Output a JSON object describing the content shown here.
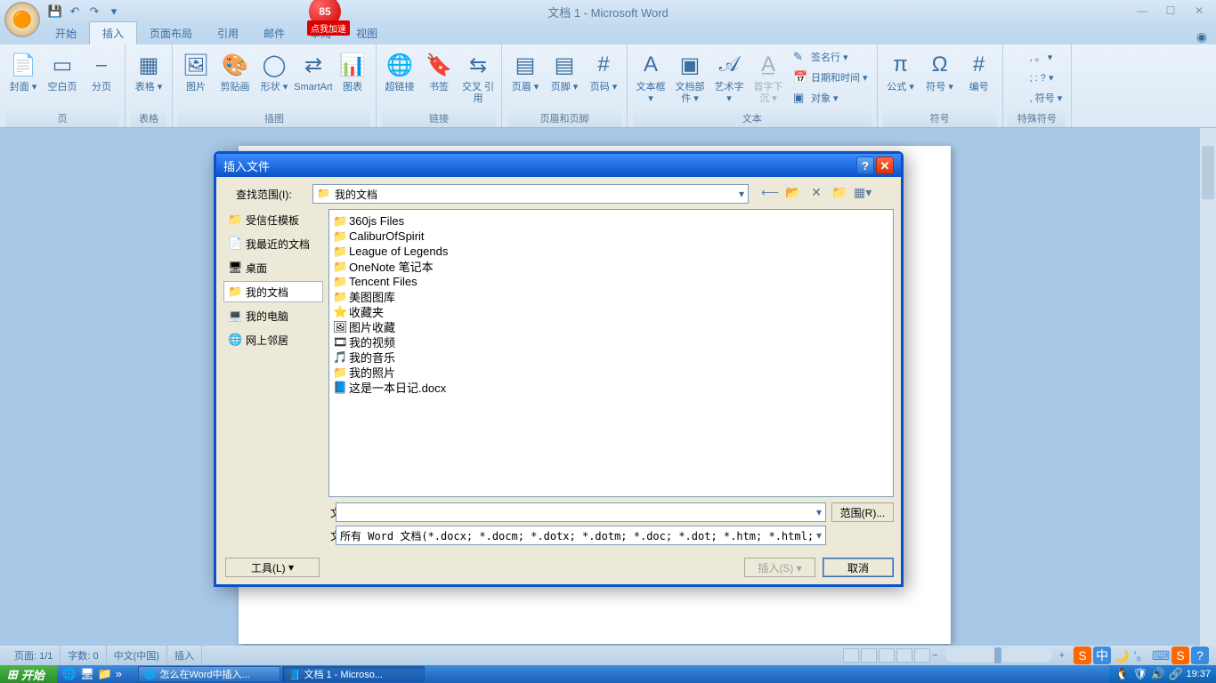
{
  "titlebar": {
    "title": "文档 1 - Microsoft Word",
    "badge_num": "85",
    "badge_text": "点我加速"
  },
  "tabs": {
    "items": [
      "开始",
      "插入",
      "页面布局",
      "引用",
      "邮件",
      "审阅",
      "视图"
    ],
    "active_index": 1
  },
  "ribbon": {
    "groups": [
      {
        "label": "页",
        "items": [
          {
            "label": "封面",
            "icon": "📄",
            "dd": true
          },
          {
            "label": "空白页",
            "icon": "▭"
          },
          {
            "label": "分页",
            "icon": "⎯"
          }
        ]
      },
      {
        "label": "表格",
        "items": [
          {
            "label": "表格",
            "icon": "▦",
            "dd": true
          }
        ]
      },
      {
        "label": "插图",
        "items": [
          {
            "label": "图片",
            "icon": "🖼"
          },
          {
            "label": "剪贴画",
            "icon": "🎨"
          },
          {
            "label": "形状",
            "icon": "◯",
            "dd": true
          },
          {
            "label": "SmartArt",
            "icon": "⇄"
          },
          {
            "label": "图表",
            "icon": "📊"
          }
        ]
      },
      {
        "label": "链接",
        "items": [
          {
            "label": "超链接",
            "icon": "🌐"
          },
          {
            "label": "书签",
            "icon": "🔖"
          },
          {
            "label": "交叉\n引用",
            "icon": "⇆"
          }
        ]
      },
      {
        "label": "页眉和页脚",
        "items": [
          {
            "label": "页眉",
            "icon": "▤",
            "dd": true
          },
          {
            "label": "页脚",
            "icon": "▤",
            "dd": true
          },
          {
            "label": "页码",
            "icon": "#",
            "dd": true
          }
        ]
      },
      {
        "label": "文本",
        "items": [
          {
            "label": "文本框",
            "icon": "A",
            "dd": true
          },
          {
            "label": "文档部件",
            "icon": "▣",
            "dd": true
          },
          {
            "label": "艺术字",
            "icon": "𝒜",
            "dd": true
          },
          {
            "label": "首字下沉",
            "icon": "A̲",
            "dd": true,
            "disabled": true
          }
        ],
        "small": [
          {
            "label": "签名行",
            "icon": "✎"
          },
          {
            "label": "日期和时间",
            "icon": "📅"
          },
          {
            "label": "对象",
            "icon": "▣"
          }
        ]
      },
      {
        "label": "符号",
        "items": [
          {
            "label": "公式",
            "icon": "π",
            "dd": true
          },
          {
            "label": "符号",
            "icon": "Ω",
            "dd": true
          },
          {
            "label": "编号",
            "icon": "#"
          }
        ]
      },
      {
        "label": "特殊符号",
        "items": [],
        "small": [
          {
            "label": ", 。",
            "icon": ""
          },
          {
            "label": "; : ?",
            "icon": ""
          },
          {
            "label": ", 符号",
            "icon": ""
          }
        ]
      }
    ]
  },
  "dialog": {
    "title": "插入文件",
    "lookin_label": "查找范围(I):",
    "lookin_value": "我的文档",
    "sidebar": [
      {
        "label": "受信任模板",
        "icon": "📁"
      },
      {
        "label": "我最近的文档",
        "icon": "📄"
      },
      {
        "label": "桌面",
        "icon": "🖥"
      },
      {
        "label": "我的文档",
        "icon": "📁",
        "selected": true
      },
      {
        "label": "我的电脑",
        "icon": "💻"
      },
      {
        "label": "网上邻居",
        "icon": "🌐"
      }
    ],
    "files": [
      {
        "name": "360js Files",
        "icon": "📁"
      },
      {
        "name": "CaliburOfSpirit",
        "icon": "📁"
      },
      {
        "name": "League of Legends",
        "icon": "📁"
      },
      {
        "name": "OneNote 笔记本",
        "icon": "📁"
      },
      {
        "name": "Tencent Files",
        "icon": "📁"
      },
      {
        "name": "美图图库",
        "icon": "📁"
      },
      {
        "name": "收藏夹",
        "icon": "⭐"
      },
      {
        "name": "图片收藏",
        "icon": "🖼"
      },
      {
        "name": "我的视频",
        "icon": "🎞"
      },
      {
        "name": "我的音乐",
        "icon": "🎵"
      },
      {
        "name": "我的照片",
        "icon": "📁"
      },
      {
        "name": "这是一本日记.docx",
        "icon": "📘"
      }
    ],
    "filename_label": "文件名(N):",
    "filename_value": "",
    "filetype_label": "文件类型(T):",
    "filetype_value": "所有 Word 文档(*.docx; *.docm; *.dotx; *.dotm; *.doc; *.dot; *.htm; *.html;",
    "range_btn": "范围(R)...",
    "tools_btn": "工具(L)",
    "insert_btn": "插入(S)",
    "cancel_btn": "取消"
  },
  "statusbar": {
    "page": "页面: 1/1",
    "words": "字数: 0",
    "lang": "中文(中国)",
    "mode": "插入"
  },
  "taskbar": {
    "start": "开始",
    "tasks": [
      {
        "label": "怎么在Word中插入...",
        "icon": "🌐"
      },
      {
        "label": "文档 1 - Microso...",
        "icon": "📘",
        "active": true
      }
    ],
    "clock": "19:37"
  }
}
